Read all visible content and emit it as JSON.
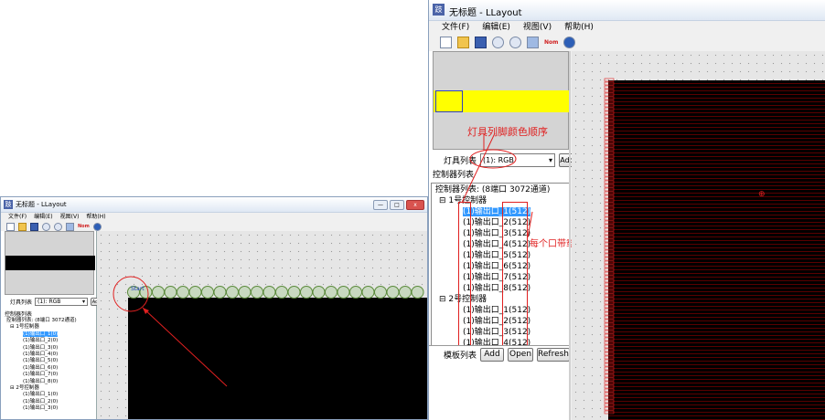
{
  "app": {
    "icon_glyph": "跂",
    "title": "无标题 - LLayout"
  },
  "window_buttons": {
    "minimize": "—",
    "maximize": "□",
    "close": "x"
  },
  "menu": [
    "文件(F)",
    "编辑(E)",
    "视图(V)",
    "帮助(H)"
  ],
  "toolbar": {
    "nom_label": "Nom",
    "icons": [
      "new-file-icon",
      "open-folder-icon",
      "save-icon",
      "undo-icon",
      "redo-icon",
      "rectangle-icon",
      "help-icon"
    ]
  },
  "lamp_list": {
    "label": "灯具列表",
    "selected": "(1): RGB",
    "add_label": "Add",
    "small_add_label": "Ad"
  },
  "controller_list": {
    "header": "控制器列表",
    "root_label": "控制器列表: (8端口 3072通道)",
    "controllers": [
      {
        "label": "1号控制器",
        "ports": [
          "(1)输出口_1(512)",
          "(1)输出口_2(512)",
          "(1)输出口_3(512)",
          "(1)输出口_4(512)",
          "(1)输出口_5(512)",
          "(1)输出口_6(512)",
          "(1)输出口_7(512)",
          "(1)输出口_8(512)"
        ]
      },
      {
        "label": "2号控制器",
        "ports": [
          "(1)输出口_1(512)",
          "(1)输出口_2(512)",
          "(1)输出口_3(512)",
          "(1)输出口_4(512)"
        ]
      }
    ],
    "small_ports_c1": [
      "(1)输出口_1(0)",
      "(1)输出口_2(0)",
      "(1)输出口_3(0)",
      "(1)输出口_4(0)",
      "(1)输出口_5(0)",
      "(1)输出口_6(0)",
      "(1)输出口_7(0)",
      "(1)输出口_8(0)"
    ],
    "small_ports_c2": [
      "(1)输出口_1(0)",
      "(1)输出口_2(0)",
      "(1)输出口_3(0)"
    ]
  },
  "template_list": {
    "label": "模板列表",
    "add_label": "Add",
    "open_label": "Open",
    "refresh_label": "Refresh"
  },
  "canvas": {
    "start_label": "Start"
  },
  "annotations": {
    "lamp_color_order": "灯具列脚颜色顺序",
    "points_per_port": "每个口带载点数",
    "marker": "⊕"
  },
  "colors": {
    "preview_strip": "#ffff00",
    "selection": "#3399ff",
    "annotation": "#e02020",
    "canvas_grid": "#c8c8c8"
  }
}
